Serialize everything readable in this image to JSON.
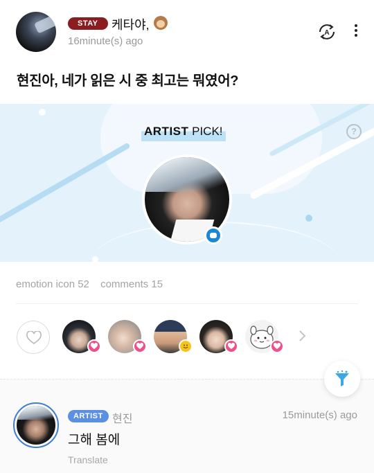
{
  "post": {
    "author_badge": "STAY",
    "author_name": "케타야,",
    "author_emoji": "monkey-face",
    "timestamp": "16minute(s) ago",
    "title": "현진아, 네가 읽은 시 중 최고는 뭐였어?"
  },
  "banner": {
    "pick_bold": "ARTIST",
    "pick_rest": " PICK!",
    "help_label": "?"
  },
  "stats": {
    "emotions": "emotion icon 52",
    "comments": "comments 15"
  },
  "reactions": {
    "reactors": [
      {
        "name": "reactor-1",
        "badge": "heart"
      },
      {
        "name": "reactor-2",
        "badge": "heart"
      },
      {
        "name": "reactor-3",
        "badge": "smile"
      },
      {
        "name": "reactor-4",
        "badge": "heart"
      },
      {
        "name": "reactor-5",
        "badge": "heart"
      }
    ]
  },
  "comment": {
    "badge": "ARTIST",
    "author": "현진",
    "time": "15minute(s) ago",
    "text": "그해 봄에",
    "translate": "Translate"
  },
  "colors": {
    "stay_badge": "#8b1c1f",
    "artist_badge": "#5b8fe0",
    "heart": "#ef4f8a",
    "smile": "#f6c51a",
    "banner_bg": "#e4f2fb",
    "accent_blue": "#1a86d4"
  }
}
